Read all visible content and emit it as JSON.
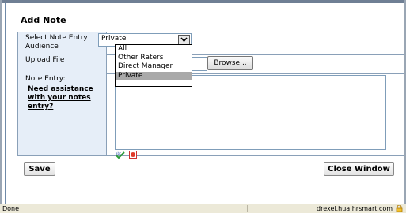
{
  "form": {
    "title": "Add Note",
    "audience_label": "Select Note Entry Audience",
    "audience_value": "Private",
    "audience_options": [
      "All",
      "Other Raters",
      "Direct Manager",
      "Private"
    ],
    "upload_label": "Upload File",
    "browse_label": "Browse...",
    "note_label": "Note Entry:",
    "help_link": "Need assistance with your notes entry?",
    "save_label": "Save",
    "close_label": "Close Window"
  },
  "statusbar": {
    "left": "Done",
    "right": "drexel.hua.hrsmart.com"
  },
  "colors": {
    "label_bg": "#e6eef8",
    "border": "#8aa0b8",
    "selected_option_bg": "#a9a9a9",
    "statusbar_bg": "#ece9d8"
  },
  "icons": [
    "spell-check-icon",
    "clear-icon",
    "lock-icon",
    "chevron-down-icon"
  ]
}
